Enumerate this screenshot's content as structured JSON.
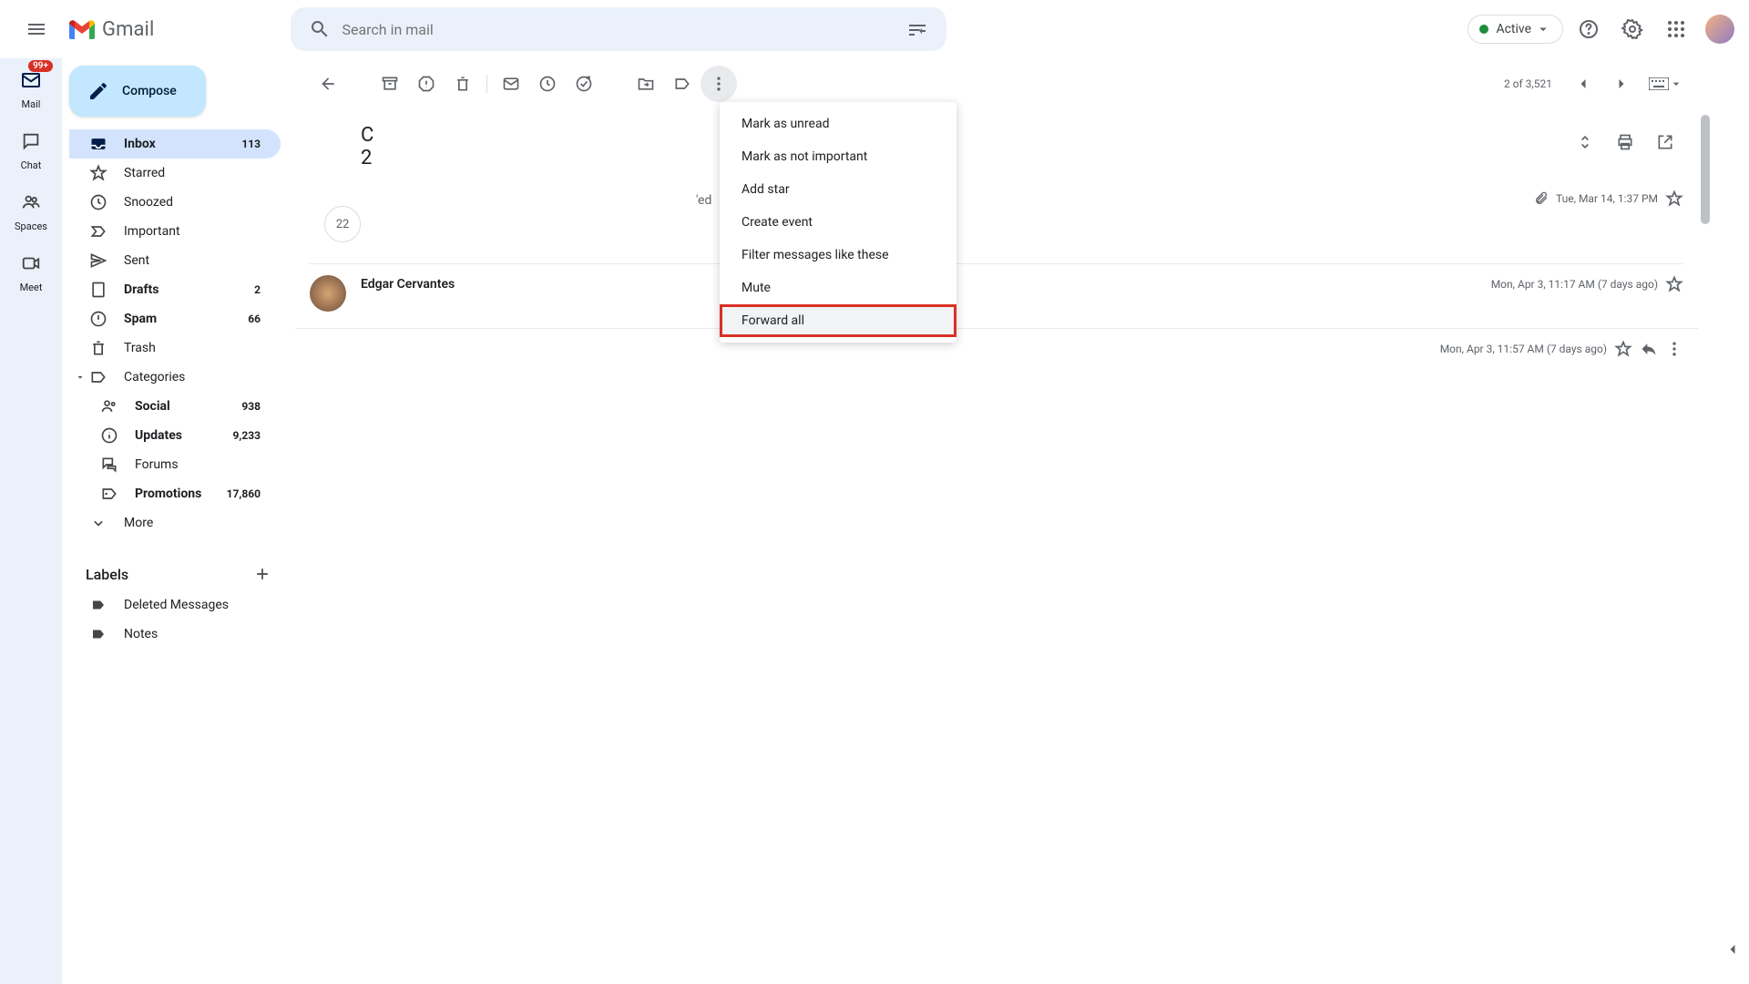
{
  "header": {
    "app_name": "Gmail",
    "search_placeholder": "Search in mail",
    "status_label": "Active"
  },
  "rail": {
    "mail": "Mail",
    "mail_badge": "99+",
    "chat": "Chat",
    "spaces": "Spaces",
    "meet": "Meet"
  },
  "sidebar": {
    "compose": "Compose",
    "items": [
      {
        "label": "Inbox",
        "count": "113",
        "active": true,
        "bold": true,
        "icon": "inbox"
      },
      {
        "label": "Starred",
        "count": "",
        "icon": "star"
      },
      {
        "label": "Snoozed",
        "count": "",
        "icon": "clock"
      },
      {
        "label": "Important",
        "count": "",
        "icon": "important"
      },
      {
        "label": "Sent",
        "count": "",
        "icon": "send"
      },
      {
        "label": "Drafts",
        "count": "2",
        "bold": true,
        "icon": "draft"
      },
      {
        "label": "Spam",
        "count": "66",
        "bold": true,
        "icon": "spam"
      },
      {
        "label": "Trash",
        "count": "",
        "icon": "trash"
      },
      {
        "label": "Categories",
        "count": "",
        "icon": "label",
        "caret": true
      },
      {
        "label": "Social",
        "count": "938",
        "bold": true,
        "indent": true,
        "icon": "people"
      },
      {
        "label": "Updates",
        "count": "9,233",
        "bold": true,
        "indent": true,
        "icon": "info"
      },
      {
        "label": "Forums",
        "count": "",
        "indent": true,
        "icon": "forum"
      },
      {
        "label": "Promotions",
        "count": "17,860",
        "bold": true,
        "indent": true,
        "icon": "tag"
      },
      {
        "label": "More",
        "count": "",
        "icon": "expand"
      }
    ],
    "labels_header": "Labels",
    "labels": [
      {
        "label": "Deleted Messages"
      },
      {
        "label": "Notes"
      }
    ]
  },
  "toolbar": {
    "counter": "2 of 3,521"
  },
  "dropdown": {
    "items": [
      "Mark as unread",
      "Mark as not important",
      "Add star",
      "Create event",
      "Filter messages like these",
      "Mute",
      "Forward all"
    ],
    "highlight_index": 6
  },
  "conversation": {
    "subject_line1": "C",
    "subject_line2": "2",
    "collapsed_count": "22",
    "partial_text_left": "'ed",
    "messages": [
      {
        "timestamp": "Tue, Mar 14, 1:37 PM",
        "has_attachment": true
      },
      {
        "sender": "Edgar Cervantes",
        "timestamp": "Mon, Apr 3, 11:17 AM (7 days ago)"
      },
      {
        "timestamp": "Mon, Apr 3, 11:57 AM (7 days ago)",
        "expanded": true
      }
    ]
  }
}
